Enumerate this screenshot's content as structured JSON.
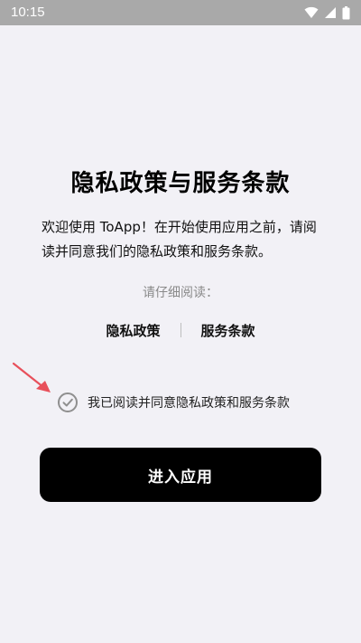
{
  "status_bar": {
    "time": "10:15",
    "icons": [
      "wifi-icon",
      "signal-icon",
      "battery-icon"
    ],
    "background": "#A9A9A9"
  },
  "title": "隐私政策与服务条款",
  "intro_text": "欢迎使用 ToApp！在开始使用应用之前，请阅读并同意我们的隐私政策和服务条款。",
  "read_hint": "请仔细阅读：",
  "links": {
    "privacy": "隐私政策",
    "terms": "服务条款"
  },
  "consent": {
    "label": "我已阅读并同意隐私政策和服务条款",
    "checked": true,
    "icon": "check-circle-icon"
  },
  "enter_button": {
    "label": "进入应用",
    "background": "#000000"
  },
  "annotation_arrow_color": "#E8505B"
}
